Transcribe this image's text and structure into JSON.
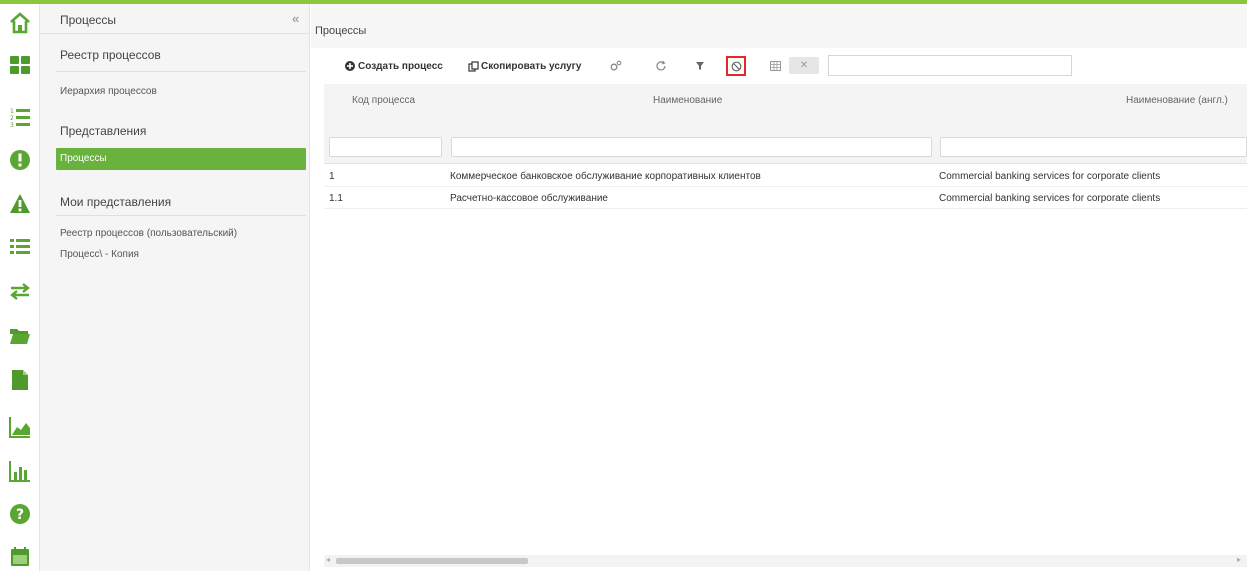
{
  "colors": {
    "accent": "#6ab23e",
    "highlight": "#e02a2a"
  },
  "rail": {
    "icons": [
      "home-icon",
      "dashboard-icon",
      "numbered-list-icon",
      "alert-circle-icon",
      "warning-icon",
      "list-icon",
      "transfer-icon",
      "folder-icon",
      "document-icon",
      "area-chart-icon",
      "bar-chart-icon",
      "help-icon",
      "calendar-icon"
    ]
  },
  "sidebar": {
    "title": "Процессы",
    "collapse_glyph": "«",
    "section1_title": "Реестр процессов",
    "item_hierarchy": "Иерархия процессов",
    "section2_title": "Представления",
    "active_item": "Процессы",
    "section3_title": "Мои представления",
    "my_views": [
      "Реестр процессов (пользовательский)",
      "Процесс\\ - Копия"
    ]
  },
  "main": {
    "title": "Процессы",
    "toolbar": {
      "create_label": "Создать процесс",
      "copy_label": "Скопировать услугу",
      "x_label": "✕",
      "search_value": ""
    },
    "table": {
      "columns": [
        "Код процесса",
        "Наименование",
        "Наименование (англ.)"
      ],
      "rows": [
        {
          "code": "1",
          "name": "Коммерческое банковское обслуживание корпоративных клиентов",
          "name_en": "Commercial banking services for corporate clients"
        },
        {
          "code": "1.1",
          "name": "Расчетно-кассовое обслуживание",
          "name_en": "Commercial banking services for corporate clients"
        }
      ]
    }
  }
}
